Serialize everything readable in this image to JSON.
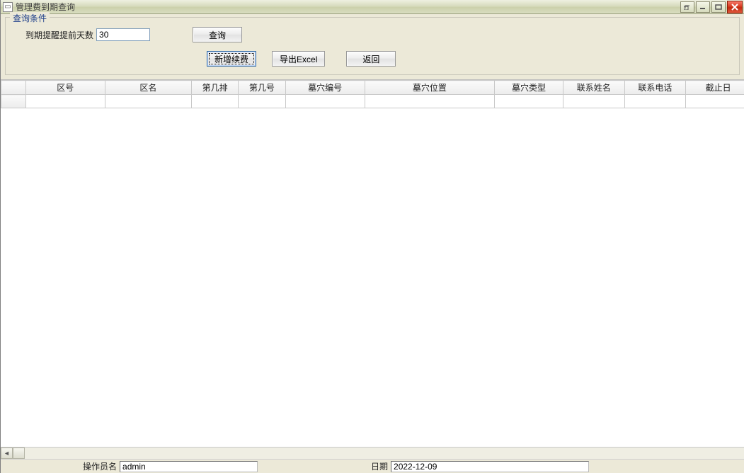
{
  "window": {
    "title": "管理费到期查询"
  },
  "query": {
    "legend": "查询条件",
    "days_label": "到期提醒提前天数",
    "days_value": "30",
    "btn_search": "查询",
    "btn_add_renew": "新增续费",
    "btn_export": "导出Excel",
    "btn_return": "返回"
  },
  "grid": {
    "columns": [
      "",
      "区号",
      "区名",
      "第几排",
      "第几号",
      "墓穴编号",
      "墓穴位置",
      "墓穴类型",
      "联系姓名",
      "联系电话",
      "截止日"
    ],
    "rows": [
      {
        "cells": [
          "",
          "",
          "",
          "",
          "",
          "",
          "",
          "",
          "",
          "",
          ""
        ]
      }
    ]
  },
  "status": {
    "operator_label": "操作员名",
    "operator_value": "admin",
    "date_label": "日期",
    "date_value": "2022-12-09"
  }
}
